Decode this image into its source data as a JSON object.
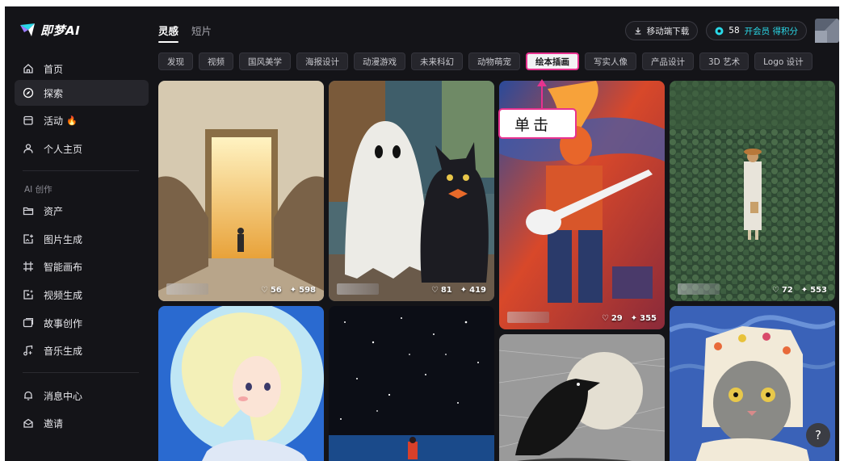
{
  "app": {
    "logo_text": "即梦AI"
  },
  "sidebar": {
    "items": [
      {
        "label": "首页",
        "icon": "home-icon"
      },
      {
        "label": "探索",
        "icon": "explore-icon",
        "active": true
      },
      {
        "label": "活动",
        "icon": "activity-icon",
        "badge_icon": "fire-icon"
      },
      {
        "label": "个人主页",
        "icon": "user-icon"
      }
    ],
    "section_label": "AI 创作",
    "create_items": [
      {
        "label": "资产",
        "icon": "folder-icon"
      },
      {
        "label": "图片生成",
        "icon": "image-gen-icon"
      },
      {
        "label": "智能画布",
        "icon": "canvas-icon"
      },
      {
        "label": "视频生成",
        "icon": "video-gen-icon"
      },
      {
        "label": "故事创作",
        "icon": "story-icon"
      },
      {
        "label": "音乐生成",
        "icon": "music-icon"
      }
    ],
    "bottom_items": [
      {
        "label": "消息中心",
        "icon": "bell-icon"
      },
      {
        "label": "邀请",
        "icon": "invite-icon"
      }
    ]
  },
  "header": {
    "tabs": [
      {
        "label": "灵感",
        "active": true
      },
      {
        "label": "短片",
        "active": false
      }
    ],
    "download_label": "移动端下载",
    "credits": "58",
    "membership_label": "开会员 得积分"
  },
  "categories": [
    "发现",
    "视频",
    "国风美学",
    "海报设计",
    "动漫游戏",
    "未来科幻",
    "动物萌宠",
    "绘本插画",
    "写实人像",
    "产品设计",
    "3D 艺术",
    "Logo 设计"
  ],
  "active_category": "绘本插画",
  "cards": [
    {
      "likes": "56",
      "remixes": "598"
    },
    {
      "likes": "81",
      "remixes": "419"
    },
    {
      "likes": "29",
      "remixes": "355"
    },
    {
      "likes": "72",
      "remixes": "553"
    }
  ],
  "annotation": {
    "text": "单击"
  },
  "help_label": "?",
  "colors": {
    "accent_cyan": "#2ad9e8",
    "annotation_pink": "#e7328f",
    "background": "#141418"
  }
}
